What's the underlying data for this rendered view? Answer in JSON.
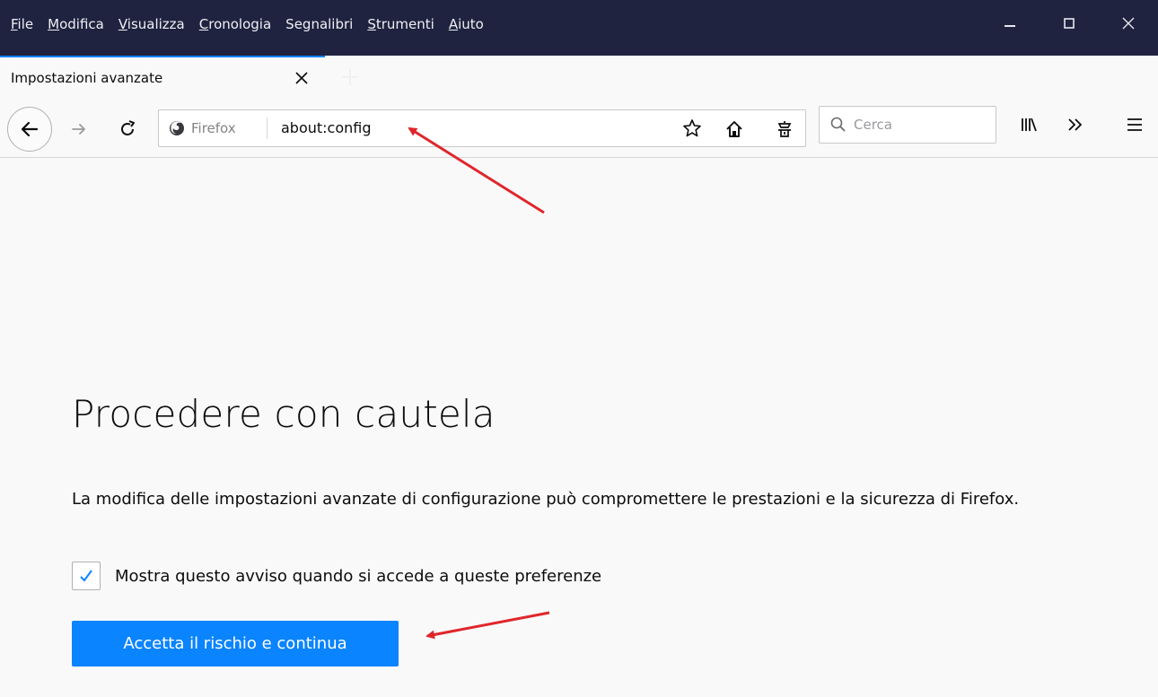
{
  "menubar": {
    "items": [
      {
        "underline": "F",
        "rest": "ile"
      },
      {
        "underline": "M",
        "rest": "odifica"
      },
      {
        "underline": "V",
        "rest": "isualizza"
      },
      {
        "underline": "C",
        "rest": "ronologia"
      },
      {
        "underline": "",
        "rest": "Segnalibri"
      },
      {
        "underline": "S",
        "rest": "trumenti"
      },
      {
        "underline": "A",
        "rest": "iuto"
      }
    ]
  },
  "tab": {
    "title": "Impostazioni avanzate"
  },
  "navbar": {
    "identity_label": "Firefox",
    "url": "about:config",
    "search_placeholder": "Cerca"
  },
  "content": {
    "title": "Procedere con cautela",
    "description": "La modifica delle impostazioni avanzate di configurazione può compromettere le prestazioni e la sicurezza di Firefox.",
    "checkbox_label": "Mostra questo avviso quando si accede a queste preferenze",
    "checkbox_checked": true,
    "accept_button": "Accetta il rischio e continua"
  },
  "colors": {
    "titlebar": "#1f2340",
    "accent": "#0a84ff",
    "annotation_arrow": "#e0262b"
  },
  "icons": [
    "back-arrow-icon",
    "forward-arrow-icon",
    "reload-icon",
    "firefox-logo-icon",
    "star-icon",
    "home-icon",
    "save-to-pocket-icon",
    "search-icon",
    "library-icon",
    "overflow-chevron-icon",
    "hamburger-menu-icon",
    "close-icon",
    "plus-icon",
    "minimize-icon",
    "maximize-icon",
    "checkmark-icon"
  ]
}
